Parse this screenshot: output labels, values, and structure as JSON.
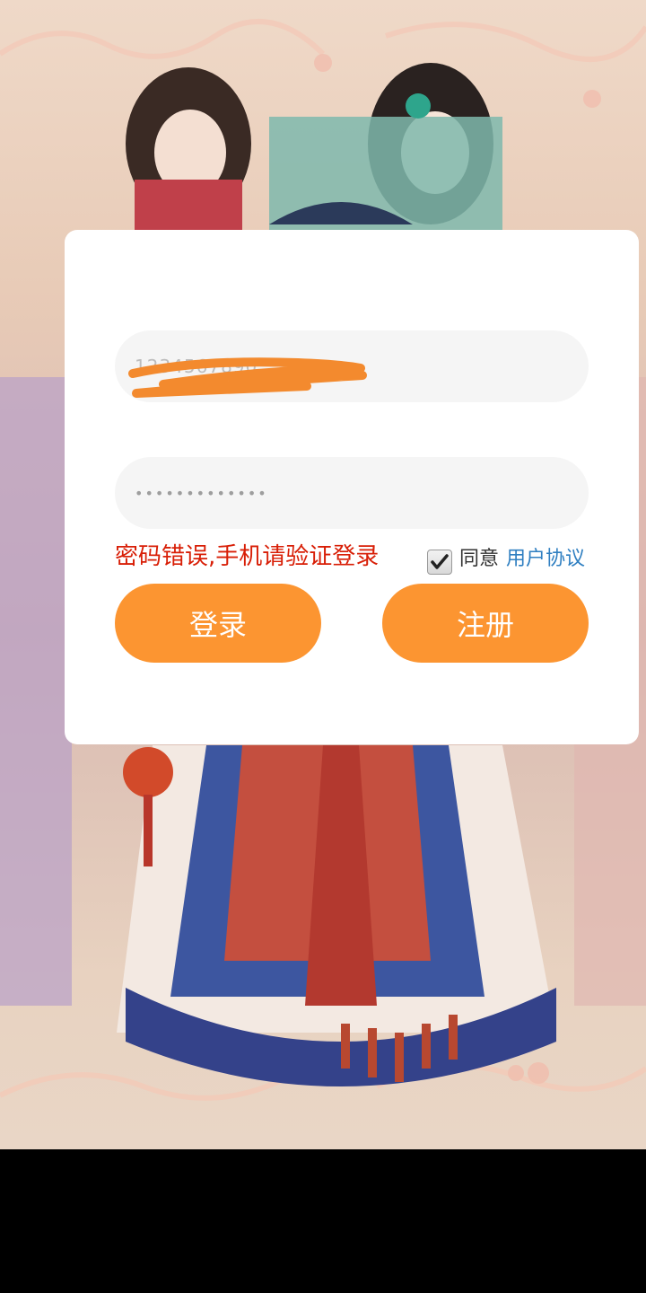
{
  "login_form": {
    "phone_value": "1234567890",
    "password_value": "•••••••••••••",
    "error_message": "密码错误,手机请验证登录",
    "agree_label": "同意",
    "agreement_link": "用户协议",
    "agree_checked": true,
    "login_label": "登录",
    "register_label": "注册"
  },
  "colors": {
    "accent": "#fc9531",
    "error": "#d81e06",
    "link": "#2f7fc1",
    "scribble": "#f38a2e"
  }
}
